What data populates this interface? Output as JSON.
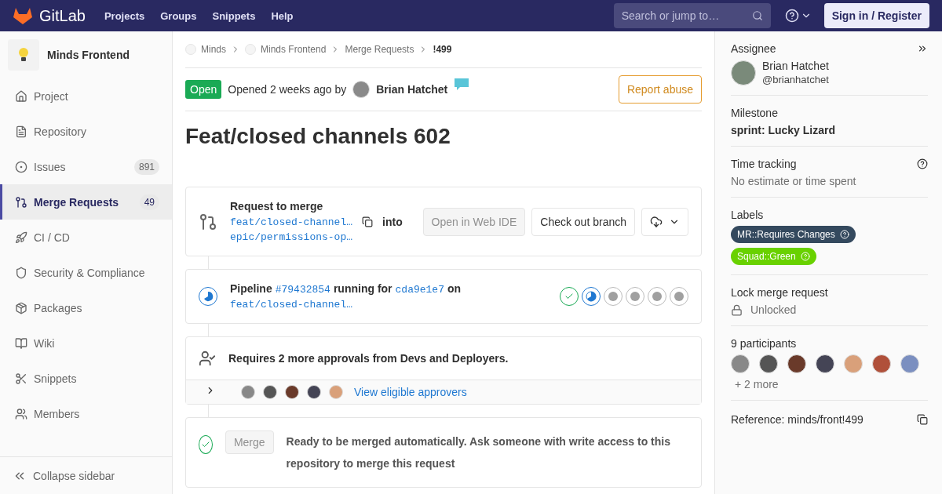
{
  "header": {
    "logo": "GitLab",
    "nav": [
      "Projects",
      "Groups",
      "Snippets",
      "Help"
    ],
    "search": {
      "placeholder": "Search or jump to…"
    },
    "sign_in": "Sign in / Register"
  },
  "sidebar": {
    "project": "Minds Frontend",
    "items": [
      {
        "label": "Project",
        "selected": false
      },
      {
        "label": "Repository",
        "selected": false
      },
      {
        "label": "Issues",
        "count": "891",
        "selected": false
      },
      {
        "label": "Merge Requests",
        "count": "49",
        "selected": true
      },
      {
        "label": "CI / CD",
        "selected": false
      },
      {
        "label": "Security & Compliance",
        "selected": false
      },
      {
        "label": "Packages",
        "selected": false
      },
      {
        "label": "Wiki",
        "selected": false
      },
      {
        "label": "Snippets",
        "selected": false
      },
      {
        "label": "Members",
        "selected": false
      }
    ],
    "collapse": "Collapse sidebar"
  },
  "breadcrumbs": [
    "Minds",
    "Minds Frontend",
    "Merge Requests",
    "!499"
  ],
  "status": {
    "badge": "Open",
    "opened": "Opened 2 weeks ago by",
    "author": "Brian Hatchet",
    "report": "Report abuse"
  },
  "title": "Feat/closed channels 602",
  "merge_request": {
    "heading": "Request to merge",
    "source": "feat/closed-channel…",
    "into": "into",
    "target": "epic/permissions-op…",
    "web_ide": "Open in Web IDE",
    "checkout": "Check out branch"
  },
  "pipeline": {
    "label": "Pipeline",
    "id": "#79432854",
    "running_for": "running for",
    "commit": "cda9e1e7",
    "on": "on",
    "branch": "feat/closed-channel…",
    "stages": [
      {
        "kind": "success"
      },
      {
        "kind": "running"
      },
      {
        "kind": "pending"
      },
      {
        "kind": "pending"
      },
      {
        "kind": "pending"
      },
      {
        "kind": "pending"
      }
    ]
  },
  "approvals": {
    "text": "Requires 2 more approvals from Devs and Deployers.",
    "link": "View eligible approvers",
    "expanded": false
  },
  "merge": {
    "button": "Merge",
    "text": "Ready to be merged automatically. Ask someone with write access to this repository to merge this request"
  },
  "right": {
    "assignee_label": "Assignee",
    "assignee_name": "Brian Hatchet",
    "assignee_handle": "@brianhatchet",
    "milestone_label": "Milestone",
    "milestone": "sprint: Lucky Lizard",
    "time_label": "Time tracking",
    "time": "No estimate or time spent",
    "labels_label": "Labels",
    "labels": [
      {
        "text": "MR::Requires Changes",
        "color": "#34495e"
      },
      {
        "text": "Squad::Green",
        "color": "#69d100"
      }
    ],
    "lock_label": "Lock merge request",
    "lock": "Unlocked",
    "participants_label": "9 participants",
    "more": "+ 2 more",
    "reference": "Reference: minds/front!499"
  }
}
